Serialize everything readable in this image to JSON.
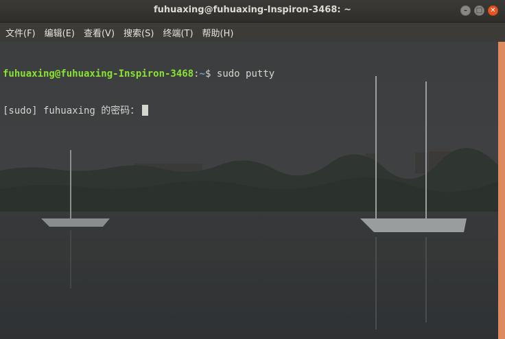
{
  "window": {
    "title": "fuhuaxing@fuhuaxing-Inspiron-3468: ~",
    "controls": [
      {
        "name": "minimize",
        "glyph": "–"
      },
      {
        "name": "maximize",
        "glyph": "□"
      },
      {
        "name": "close",
        "glyph": "✕"
      }
    ]
  },
  "menubar": {
    "items": [
      "文件(F)",
      "编辑(E)",
      "查看(V)",
      "搜索(S)",
      "终端(T)",
      "帮助(H)"
    ]
  },
  "terminal": {
    "line1": {
      "user_host": "fuhuaxing@fuhuaxing-Inspiron-3468",
      "separator": ":",
      "path": "~",
      "prompt_symbol": "$",
      "command": " sudo putty"
    },
    "line2": {
      "text": "[sudo] fuhuaxing 的密码："
    }
  },
  "colors": {
    "prompt_user": "#8ae234",
    "prompt_path": "#729fcf",
    "text": "#d3d7cf",
    "scrollbar": "#dd8a60",
    "close_button": "#e95420"
  }
}
